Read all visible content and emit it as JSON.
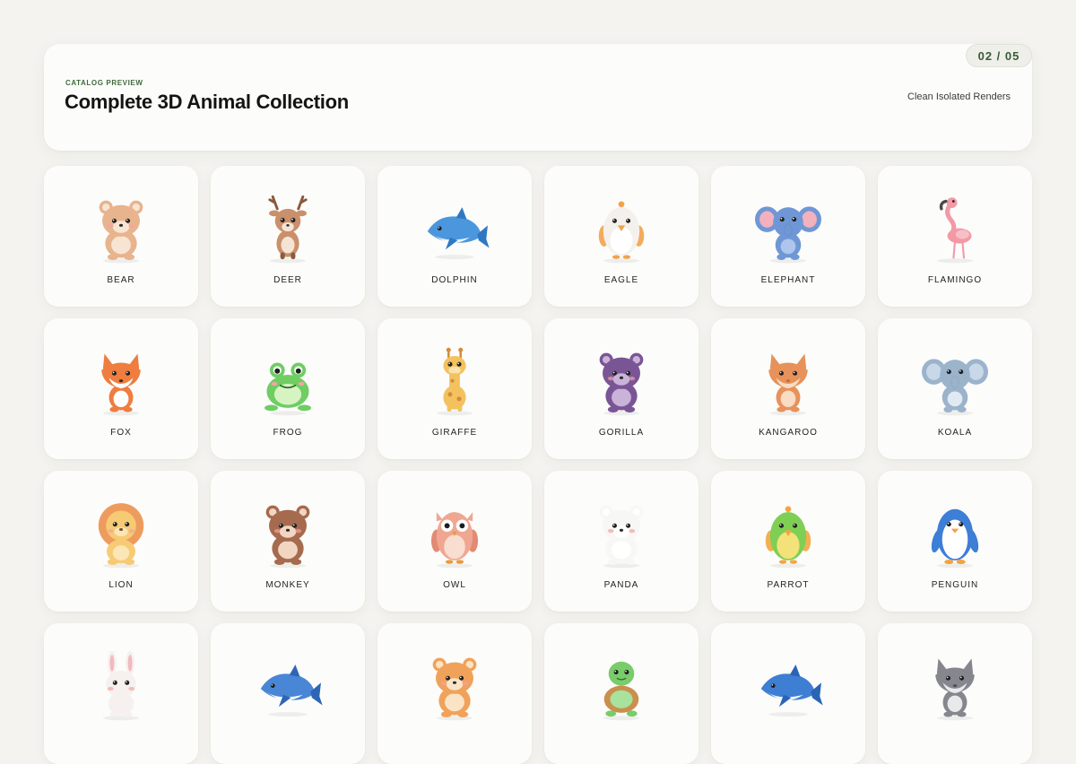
{
  "header": {
    "eyebrow": "CATALOG PREVIEW",
    "title": "Complete 3D Animal Collection",
    "subtitle": "Clean Isolated Renders",
    "page_indicator": "02 / 05"
  },
  "animals": [
    {
      "label": "BEAR",
      "icon": "bear-icon",
      "kind": "round",
      "body": "#e7b48e",
      "belly": "#f8e4d2",
      "accent": "#d59c75"
    },
    {
      "label": "DEER",
      "icon": "deer-icon",
      "kind": "antlers",
      "body": "#c9906b",
      "belly": "#f5e4d4",
      "accent": "#8b5a3c"
    },
    {
      "label": "DOLPHIN",
      "icon": "dolphin-icon",
      "kind": "swim",
      "body": "#4b97dd",
      "belly": "#eef5fb",
      "accent": "#2f78c2"
    },
    {
      "label": "EAGLE",
      "icon": "eagle-icon",
      "kind": "bird",
      "body": "#f4f1ec",
      "belly": "#ffffff",
      "accent": "#f2a24a"
    },
    {
      "label": "ELEPHANT",
      "icon": "elephant-icon",
      "kind": "bigears",
      "body": "#6f97d6",
      "belly": "#aec5ec",
      "accent": "#f3b1bd"
    },
    {
      "label": "FLAMINGO",
      "icon": "flamingo-icon",
      "kind": "tall",
      "body": "#f19aa6",
      "belly": "#f7c0c6",
      "accent": "#4a4a4a"
    },
    {
      "label": "FOX",
      "icon": "fox-icon",
      "kind": "pointy",
      "body": "#ee7d3f",
      "belly": "#ffffff",
      "accent": "#3a2a22"
    },
    {
      "label": "FROG",
      "icon": "frog-icon",
      "kind": "frog",
      "body": "#6fcd63",
      "belly": "#d6f3c2",
      "accent": "#f4a5a5"
    },
    {
      "label": "GIRAFFE",
      "icon": "giraffe-icon",
      "kind": "giraffe",
      "body": "#f3c25f",
      "belly": "#fae3ad",
      "accent": "#d68a3a"
    },
    {
      "label": "GORILLA",
      "icon": "gorilla-icon",
      "kind": "round",
      "body": "#7a5596",
      "belly": "#c9b3d9",
      "accent": "#5b3c75"
    },
    {
      "label": "KANGAROO",
      "icon": "kangaroo-icon",
      "kind": "pointy",
      "body": "#e7925a",
      "belly": "#f8dcc3",
      "accent": "#c46e3a"
    },
    {
      "label": "KOALA",
      "icon": "koala-icon",
      "kind": "bigears",
      "body": "#9cb3cc",
      "belly": "#e1e9f2",
      "accent": "#c9d8e8"
    },
    {
      "label": "LION",
      "icon": "lion-icon",
      "kind": "mane",
      "body": "#f6cb74",
      "belly": "#fbe6b6",
      "accent": "#ee9b5e"
    },
    {
      "label": "MONKEY",
      "icon": "monkey-icon",
      "kind": "round",
      "body": "#a66a4e",
      "belly": "#f1d6c2",
      "accent": "#8a5238"
    },
    {
      "label": "OWL",
      "icon": "owl-icon",
      "kind": "owl",
      "body": "#efa792",
      "belly": "#f8ddd1",
      "accent": "#e38a74"
    },
    {
      "label": "PANDA",
      "icon": "panda-icon",
      "kind": "round",
      "body": "#f7f7f5",
      "belly": "#ffffff",
      "accent": "#252525"
    },
    {
      "label": "PARROT",
      "icon": "parrot-icon",
      "kind": "bird",
      "body": "#7fcf55",
      "belly": "#f3e27a",
      "accent": "#f3a640"
    },
    {
      "label": "PENGUIN",
      "icon": "penguin-icon",
      "kind": "penguin",
      "body": "#3d7ed6",
      "belly": "#ffffff",
      "accent": "#f5a23d"
    },
    {
      "label": "",
      "icon": "rabbit-icon",
      "kind": "bunny",
      "body": "#f6f1ee",
      "belly": "#ffffff",
      "accent": "#f2b9c0"
    },
    {
      "label": "",
      "icon": "shark-icon",
      "kind": "swim",
      "body": "#4a86d6",
      "belly": "#ffffff",
      "accent": "#2e66b5"
    },
    {
      "label": "",
      "icon": "tiger-icon",
      "kind": "round",
      "body": "#f0a25a",
      "belly": "#fbe4c6",
      "accent": "#6b4330"
    },
    {
      "label": "",
      "icon": "turtle-icon",
      "kind": "turtle",
      "body": "#78cc6a",
      "belly": "#c98f4e",
      "accent": "#a8e29c"
    },
    {
      "label": "",
      "icon": "whale-icon",
      "kind": "swim",
      "body": "#3e7fd3",
      "belly": "#f3f7fb",
      "accent": "#2a64b5"
    },
    {
      "label": "",
      "icon": "wolf-icon",
      "kind": "pointy",
      "body": "#85868e",
      "belly": "#e9e9eb",
      "accent": "#4f5057"
    }
  ]
}
